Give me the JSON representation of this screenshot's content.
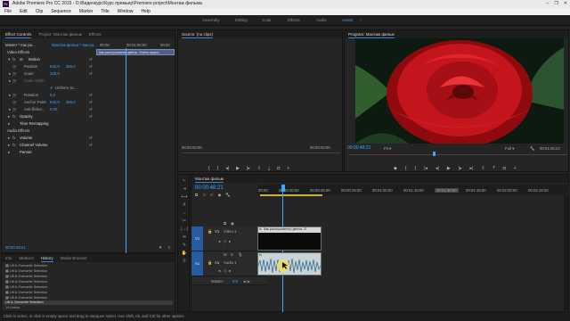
{
  "app": {
    "title": "Adobe Premiere Pro CC 2015 - D:\\Видеокурс\\Курс премьер\\Premiere project\\Монтаж фильма",
    "icon": "Pr",
    "window_controls": [
      "─",
      "❐",
      "✕"
    ]
  },
  "menu": [
    "File",
    "Edit",
    "Clip",
    "Sequence",
    "Marker",
    "Title",
    "Window",
    "Help"
  ],
  "workspaces": [
    "Assembly",
    "Editing",
    "Color",
    "Effects",
    "Audio",
    "Assist"
  ],
  "workspace_active": "Assist",
  "effect_controls": {
    "tabs": [
      "Effect Controls",
      "Project: Монтаж фильм",
      "Effects"
    ],
    "master_label": "Master * Как ра...",
    "clip_label": "Монтаж фильм * Как ра...",
    "ruler": [
      "00:00",
      "00:01:00:00",
      "00:02"
    ],
    "clip_bar": "Как распускается цветок. Очень краси",
    "section_video": "Video Effects",
    "motion": "Motion",
    "position_label": "Position",
    "position_x": "640,0",
    "position_y": "360,0",
    "scale_label": "Scale",
    "scale_val": "100,0",
    "scale_width_label": "Scale Width",
    "uniform_label": "Uniform Sc...",
    "rotation_label": "Rotation",
    "rotation_val": "0,0",
    "anchor_label": "Anchor Point",
    "anchor_x": "640,0",
    "anchor_y": "360,0",
    "antiflicker_label": "Anti-flicker...",
    "antiflicker_val": "0,00",
    "opacity": "Opacity",
    "time_remap": "Time Remapping",
    "section_audio": "Audio Effects",
    "volume": "Volume",
    "channel_volume": "Channel Volume",
    "panner": "Panner",
    "timecode": "00:00:48:21"
  },
  "history": {
    "tabs": [
      "Info",
      "Markers",
      "History",
      "Media Browser"
    ],
    "items": [
      "Lift & Overwrite Selection",
      "Lift & Overwrite Selection",
      "Lift & Overwrite Selection",
      "Lift & Overwrite Selection",
      "Lift & Overwrite Selection",
      "Lift & Overwrite Selection",
      "Lift & Overwrite Selection",
      "Lift & Overwrite Selection"
    ],
    "selected": "Lift & Overwrite Selection",
    "undos": "14 Undos"
  },
  "source": {
    "tab": "Source: (no clips)",
    "tc_left": "00:00:00:00",
    "tc_right": "00:00:00:00"
  },
  "program": {
    "tab": "Program: Монтаж фильм",
    "timecode": "00:00:48:21",
    "fit": "Fit",
    "quality": "Full",
    "duration": "00:01:06:23"
  },
  "timeline": {
    "tab": "Монтаж фильм",
    "timecode": "00:00:48:21",
    "ruler": [
      "00:00",
      "00:00:30:00",
      "00:00:30:00",
      "00:00:45:00",
      "00:01:00:00",
      "00:01:15:00",
      "00:01:30:00",
      "00:01:45:00",
      "00:02:00:00",
      "00:02:15:00"
    ],
    "v1": "V1",
    "v1_name": "Video 1",
    "a1": "A1",
    "a1_name": "Audio 1",
    "master": "Master",
    "master_val": "0,0",
    "clip_label": "Как распускается цветок. О"
  },
  "status": "Click to select, or click in empty space and drag to marquee select. Use Shift, Alt, and Ctrl for other options.",
  "colors": {
    "accent": "#3da7ff",
    "track_btn": "#275d9e",
    "rose": "#c4151c"
  }
}
